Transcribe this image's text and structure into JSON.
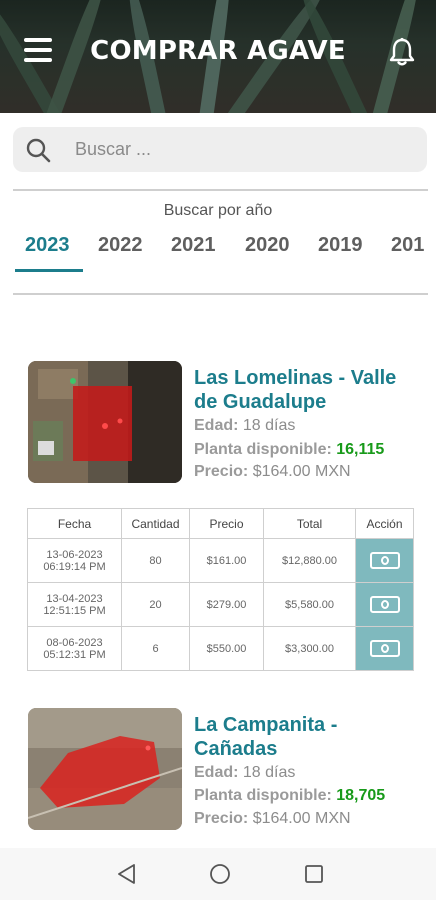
{
  "header": {
    "title": "COMPRAR AGAVE",
    "menu_icon": "menu-icon",
    "bell_icon": "bell-icon"
  },
  "search": {
    "placeholder": "Buscar ...",
    "value": "",
    "icon": "search-icon"
  },
  "year_filter": {
    "label": "Buscar por año",
    "years": [
      "2023",
      "2022",
      "2021",
      "2020",
      "2019",
      "201"
    ],
    "selected": "2023"
  },
  "listings": [
    {
      "title_line1": "Las Lomelinas - Valle",
      "title_line2": "de Guadalupe",
      "age_label": "Edad:",
      "age_value": "18 días",
      "plant_label": "Planta disponible:",
      "plant_value": "16,115",
      "price_label": "Precio:",
      "price_value": "$164.00 MXN"
    },
    {
      "title_line1": "La Campanita -",
      "title_line2": "Cañadas",
      "age_label": "Edad:",
      "age_value": "18 días",
      "plant_label": "Planta disponible:",
      "plant_value": "18,705",
      "price_label": "Precio:",
      "price_value": "$164.00 MXN"
    }
  ],
  "table": {
    "headers": [
      "Fecha",
      "Cantidad",
      "Precio",
      "Total",
      "Acción"
    ],
    "rows": [
      {
        "date": "13-06-2023",
        "time": "06:19:14 PM",
        "qty": "80",
        "price": "$161.00",
        "total": "$12,880.00"
      },
      {
        "date": "13-04-2023",
        "time": "12:51:15 PM",
        "qty": "20",
        "price": "$279.00",
        "total": "$5,580.00"
      },
      {
        "date": "08-06-2023",
        "time": "05:12:31 PM",
        "qty": "6",
        "price": "$550.00",
        "total": "$3,300.00"
      }
    ],
    "action_icon": "cash-icon"
  },
  "colors": {
    "accent": "#1c7d8c",
    "green": "#189a1a",
    "action_bg": "#7fb9be"
  }
}
